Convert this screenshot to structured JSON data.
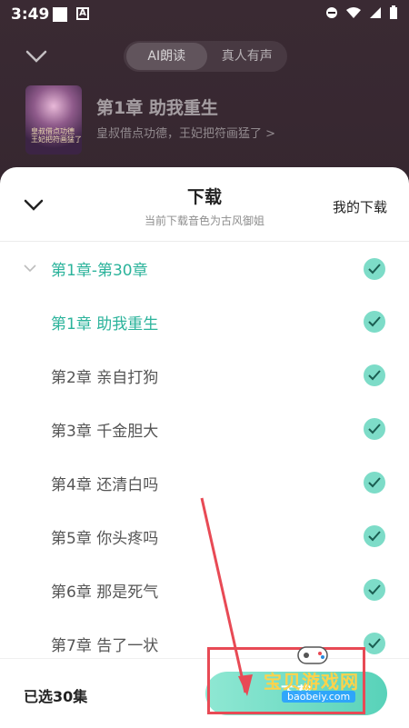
{
  "status_bar": {
    "time": "3:49",
    "badge_letter": "A"
  },
  "player": {
    "mode_options": [
      "AI朗读",
      "真人有声"
    ],
    "book_title": "第1章  助我重生",
    "book_subtitle": "皇叔借点功德，王妃把符画猛了 >",
    "cover_text": [
      "皇叔借点功德",
      "王妃把符画猛了"
    ]
  },
  "sheet": {
    "title": "下载",
    "subtitle": "当前下载音色为古风御姐",
    "my_downloads": "我的下载",
    "group_label": "第1章-第30章",
    "chapters": [
      {
        "label": "第1章  助我重生",
        "active": true
      },
      {
        "label": "第2章  亲自打狗"
      },
      {
        "label": "第3章  千金胆大"
      },
      {
        "label": "第4章  还清白吗"
      },
      {
        "label": "第5章  你头疼吗"
      },
      {
        "label": "第6章  那是死气"
      },
      {
        "label": "第7章  告了一状"
      }
    ]
  },
  "bottom": {
    "selected_count": "已选30集",
    "download_button": "下载"
  },
  "watermark": {
    "text": "宝贝游戏网",
    "url": "baobeiy.com"
  },
  "colors": {
    "accent": "#2bb39b",
    "check": "#7ddcc8",
    "annotation": "#e84a55"
  }
}
